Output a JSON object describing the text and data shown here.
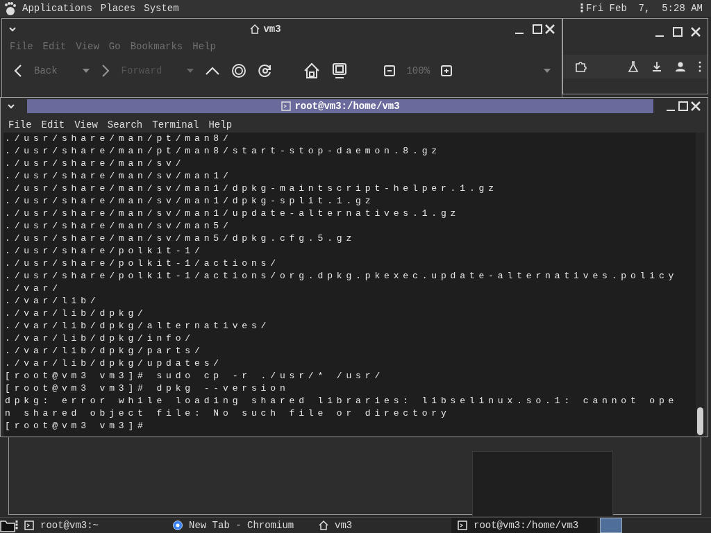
{
  "top_panel": {
    "menus": [
      "Applications",
      "Places",
      "System"
    ],
    "clock": "Fri Feb  7,  5:28 AM"
  },
  "file_manager": {
    "title": "vm3",
    "menu": [
      "File",
      "Edit",
      "View",
      "Go",
      "Bookmarks",
      "Help"
    ],
    "back": "Back",
    "forward": "Forward",
    "zoom": "100%"
  },
  "terminal": {
    "title": "root@vm3:/home/vm3",
    "menu": [
      "File",
      "Edit",
      "View",
      "Search",
      "Terminal",
      "Help"
    ],
    "lines": [
      "./usr/share/man/pt/man8/",
      "./usr/share/man/pt/man8/start-stop-daemon.8.gz",
      "./usr/share/man/sv/",
      "./usr/share/man/sv/man1/",
      "./usr/share/man/sv/man1/dpkg-maintscript-helper.1.gz",
      "./usr/share/man/sv/man1/dpkg-split.1.gz",
      "./usr/share/man/sv/man1/update-alternatives.1.gz",
      "./usr/share/man/sv/man5/",
      "./usr/share/man/sv/man5/dpkg.cfg.5.gz",
      "./usr/share/polkit-1/",
      "./usr/share/polkit-1/actions/",
      "./usr/share/polkit-1/actions/org.dpkg.pkexec.update-alternatives.policy",
      "./var/",
      "./var/lib/",
      "./var/lib/dpkg/",
      "./var/lib/dpkg/alternatives/",
      "./var/lib/dpkg/info/",
      "./var/lib/dpkg/parts/",
      "./var/lib/dpkg/updates/",
      "[root@vm3 vm3]# sudo cp -r ./usr/* /usr/",
      "[root@vm3 vm3]# dpkg --version",
      "dpkg: error while loading shared libraries: libselinux.so.1: cannot ope",
      "n shared object file: No such file or directory",
      "[root@vm3 vm3]#"
    ]
  },
  "taskbar": {
    "items": [
      {
        "label": "root@vm3:~",
        "kind": "terminal",
        "selected": false
      },
      {
        "label": "New Tab - Chromium",
        "kind": "browser",
        "selected": false
      },
      {
        "label": "vm3",
        "kind": "home",
        "selected": false
      },
      {
        "label": "root@vm3:/home/vm3",
        "kind": "terminal",
        "selected": true
      }
    ]
  }
}
